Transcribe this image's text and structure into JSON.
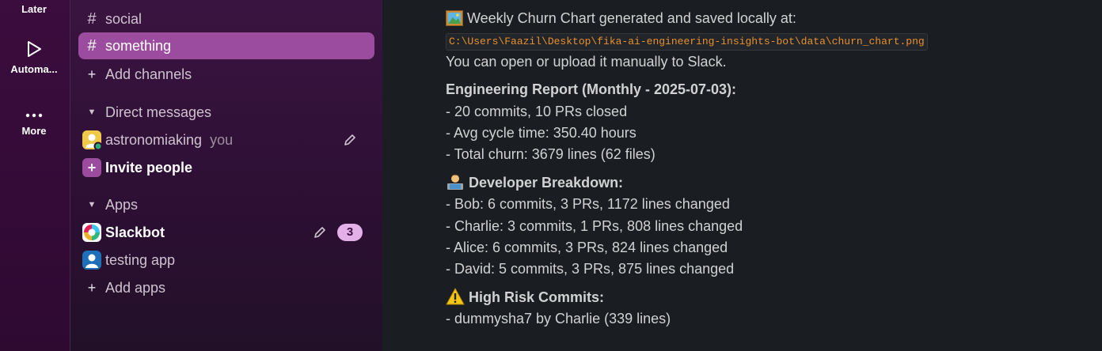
{
  "rail": {
    "later_label": "Later",
    "automations_label": "Automa...",
    "more_label": "More"
  },
  "sidebar": {
    "channels": [
      {
        "name": "social",
        "active": false
      },
      {
        "name": "something",
        "active": true
      }
    ],
    "add_channels_label": "Add channels",
    "dm_header": "Direct messages",
    "dm_user": "astronomiaking",
    "dm_you": "you",
    "invite_label": "Invite people",
    "apps_header": "Apps",
    "apps": [
      {
        "name": "Slackbot",
        "badge": "3"
      },
      {
        "name": "testing app"
      }
    ],
    "add_apps_label": "Add apps"
  },
  "message": {
    "chart_line": "Weekly Churn Chart generated and saved locally at:",
    "chart_path": "C:\\Users\\Faazil\\Desktop\\fika-ai-engineering-insights-bot\\data\\churn_chart.png",
    "open_line": "You can open or upload it manually to Slack.",
    "report_title": "Engineering Report (Monthly - 2025-07-03):",
    "report_lines": [
      "- 20 commits, 10 PRs closed",
      "- Avg cycle time: 350.40 hours",
      "- Total churn: 3679 lines (62 files)"
    ],
    "breakdown_title": "Developer Breakdown:",
    "breakdown_lines": [
      "- Bob: 6 commits, 3 PRs, 1172 lines changed",
      "- Charlie: 3 commits, 1 PRs, 808 lines changed",
      "- Alice: 6 commits, 3 PRs, 824 lines changed",
      "- David: 5 commits, 3 PRs, 875 lines changed"
    ],
    "risk_title": "High Risk Commits:",
    "risk_lines": [
      "- dummysha7 by Charlie (339 lines)"
    ]
  },
  "colors": {
    "rail_bg": "#3b0c3e",
    "active_channel_bg": "#9b4c9e",
    "badge_bg": "#e3b0e8",
    "code_text": "#e8912d",
    "main_bg": "#1a1d21"
  },
  "icons": {
    "rail": [
      "play-icon",
      "more-dots-icon"
    ],
    "emoji": [
      "framed-picture-emoji",
      "technologist-emoji",
      "warning-emoji"
    ]
  }
}
